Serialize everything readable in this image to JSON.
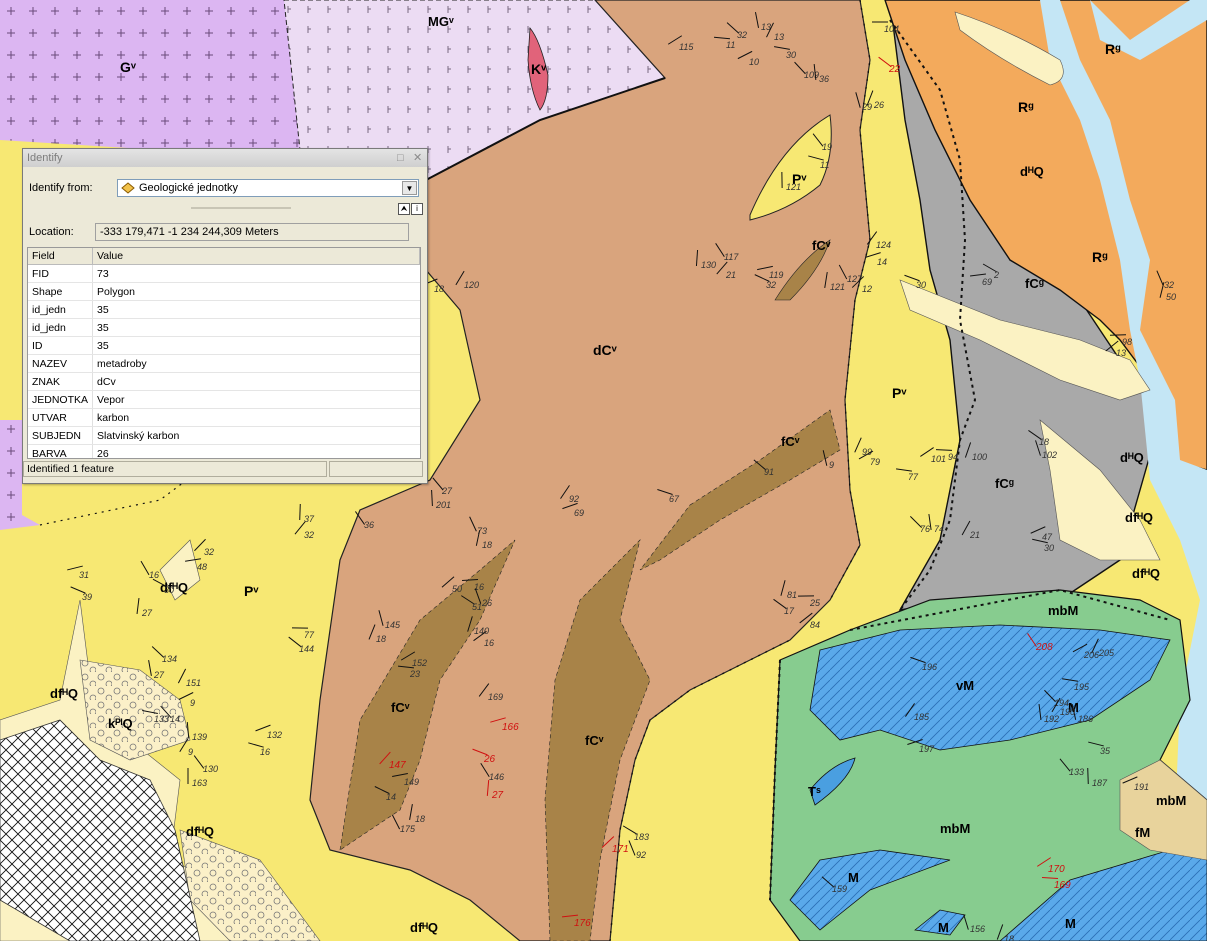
{
  "identify_window": {
    "title": "Identify",
    "identify_from_label": "Identify from:",
    "layer": "Geologické jednotky",
    "location_label": "Location:",
    "location_value": "-333 179,471  -1 234 244,309 Meters",
    "columns": [
      "Field",
      "Value"
    ],
    "rows": [
      {
        "field": "FID",
        "value": "73"
      },
      {
        "field": "Shape",
        "value": "Polygon"
      },
      {
        "field": "id_jedn",
        "value": "35"
      },
      {
        "field": "id_jedn",
        "value": "35"
      },
      {
        "field": "ID",
        "value": "35"
      },
      {
        "field": "NAZEV",
        "value": "metadroby"
      },
      {
        "field": "ZNAK",
        "value": "dCv"
      },
      {
        "field": "JEDNOTKA",
        "value": "Vepor"
      },
      {
        "field": "UTVAR",
        "value": "karbon"
      },
      {
        "field": "SUBJEDN",
        "value": "Slatvinský karbon"
      },
      {
        "field": "BARVA",
        "value": "26"
      }
    ],
    "status": "Identified 1 feature"
  },
  "map": {
    "unit_labels": {
      "gv": "Gᵛ",
      "mgv": "MGᵛ",
      "kv": "Kᵛ",
      "rg1": "Rᵍ",
      "rg2": "Rᵍ",
      "rg3": "Rᵍ",
      "pv1": "Pᵛ",
      "pv2": "Pᵛ",
      "pv3": "Pᵛ",
      "dcv": "dCᵛ",
      "fcv1": "fCᵛ",
      "fcv2": "fCᵛ",
      "fcv3": "fCᵛ",
      "fcv4": "fCᵛ",
      "fcg1": "fCᵍ",
      "fcg2": "fCᵍ",
      "mbm1": "mbM",
      "mbm2": "mbM",
      "mbm3": "mbM",
      "vm1": "vM",
      "vm2": "M",
      "vm3": "M",
      "vm4": "M",
      "vm5": "M",
      "q1": "dᴴQ",
      "q2": "dᴴQ",
      "q3": "dfᴴQ",
      "q4": "dfᴴQ",
      "q5": "dfᴴQ",
      "q6": "dfᴴQ",
      "q7": "dfᴴQ",
      "q8": "dfᴴQ",
      "q9": "kᴾˡQ",
      "ts": "Tˢ",
      "fm": "fM"
    },
    "measurements": [
      "104",
      "22",
      "29",
      "26",
      "115",
      "11",
      "32",
      "13",
      "13",
      "10",
      "30",
      "109",
      "36",
      "120",
      "18",
      "11",
      "19",
      "121",
      "124",
      "14",
      "30",
      "117",
      "130",
      "21",
      "119",
      "32",
      "127",
      "121",
      "12",
      "69",
      "2",
      "32",
      "50",
      "13",
      "98",
      "18",
      "102",
      "100",
      "101",
      "94",
      "91",
      "9",
      "99",
      "79",
      "77",
      "76",
      "74",
      "21",
      "47",
      "30",
      "27",
      "201",
      "92",
      "69",
      "67",
      "36",
      "37",
      "32",
      "31",
      "39",
      "16",
      "27",
      "32",
      "48",
      "30",
      "73",
      "18",
      "50",
      "16",
      "51",
      "26",
      "140",
      "16",
      "77",
      "144",
      "145",
      "18",
      "152",
      "23",
      "134",
      "27",
      "151",
      "9",
      "133",
      "14",
      "139",
      "9",
      "132",
      "16",
      "130",
      "163",
      "169",
      "166",
      "26",
      "146",
      "27",
      "147",
      "149",
      "14",
      "175",
      "18",
      "171",
      "176",
      "183",
      "92",
      "81",
      "84",
      "25",
      "17",
      "156",
      "18",
      "170",
      "169",
      "159",
      "186",
      "205",
      "206",
      "195",
      "194",
      "192",
      "190",
      "191",
      "35",
      "133",
      "187",
      "185",
      "197",
      "196",
      "208",
      "209"
    ]
  }
}
